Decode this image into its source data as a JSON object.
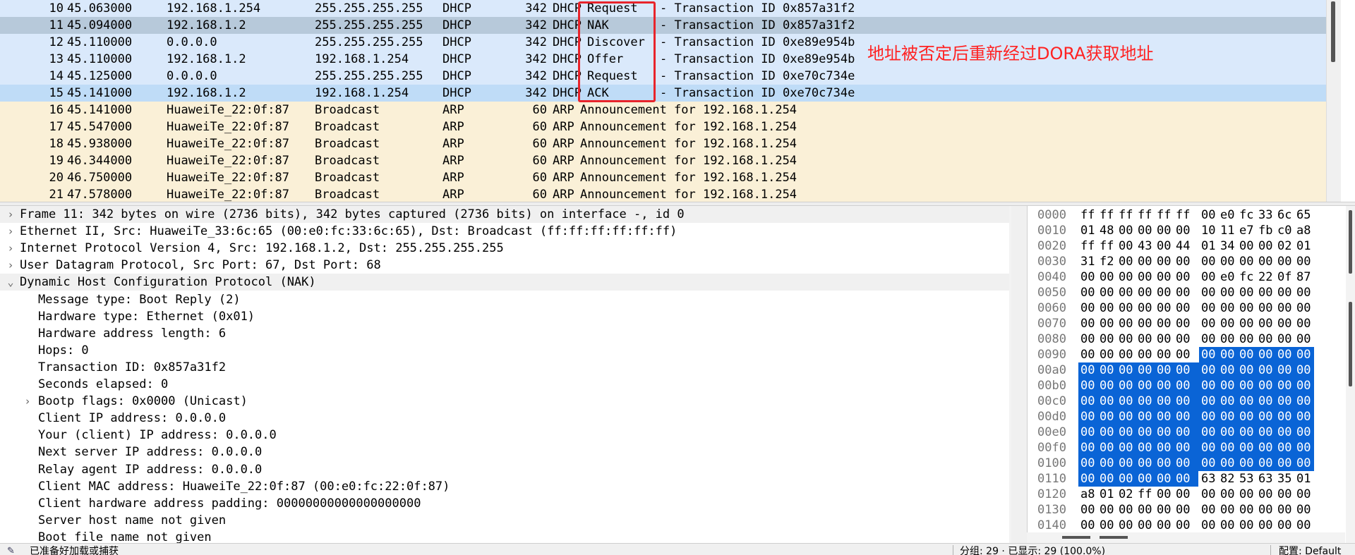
{
  "packet_list": {
    "rows": [
      {
        "no": "10",
        "time": "45.063000",
        "src": "192.168.1.254",
        "dst": "255.255.255.255",
        "proto": "DHCP",
        "len": "342",
        "info_proto": "DHCP",
        "info_type": "Request",
        "info_rest": "- Transaction ID 0x857a31f2",
        "kind": "dhcp"
      },
      {
        "no": "11",
        "time": "45.094000",
        "src": "192.168.1.2",
        "dst": "255.255.255.255",
        "proto": "DHCP",
        "len": "342",
        "info_proto": "DHCP",
        "info_type": "NAK",
        "info_rest": "- Transaction ID 0x857a31f2",
        "kind": "selected"
      },
      {
        "no": "12",
        "time": "45.110000",
        "src": "0.0.0.0",
        "dst": "255.255.255.255",
        "proto": "DHCP",
        "len": "342",
        "info_proto": "DHCP",
        "info_type": "Discover",
        "info_rest": "- Transaction ID 0xe89e954b",
        "kind": "dhcp"
      },
      {
        "no": "13",
        "time": "45.110000",
        "src": "192.168.1.2",
        "dst": "192.168.1.254",
        "proto": "DHCP",
        "len": "342",
        "info_proto": "DHCP",
        "info_type": "Offer",
        "info_rest": "- Transaction ID 0xe89e954b",
        "kind": "dhcp"
      },
      {
        "no": "14",
        "time": "45.125000",
        "src": "0.0.0.0",
        "dst": "255.255.255.255",
        "proto": "DHCP",
        "len": "342",
        "info_proto": "DHCP",
        "info_type": "Request",
        "info_rest": "- Transaction ID 0xe70c734e",
        "kind": "dhcp"
      },
      {
        "no": "15",
        "time": "45.141000",
        "src": "192.168.1.2",
        "dst": "192.168.1.254",
        "proto": "DHCP",
        "len": "342",
        "info_proto": "DHCP",
        "info_type": "ACK",
        "info_rest": "- Transaction ID 0xe70c734e",
        "kind": "highlight"
      },
      {
        "no": "16",
        "time": "45.141000",
        "src": "HuaweiTe_22:0f:87",
        "dst": "Broadcast",
        "proto": "ARP",
        "len": "60",
        "info_proto": "ARP",
        "info_type": "Announcement for 192.168.1.254",
        "info_rest": "",
        "kind": "arp"
      },
      {
        "no": "17",
        "time": "45.547000",
        "src": "HuaweiTe_22:0f:87",
        "dst": "Broadcast",
        "proto": "ARP",
        "len": "60",
        "info_proto": "ARP",
        "info_type": "Announcement for 192.168.1.254",
        "info_rest": "",
        "kind": "arp"
      },
      {
        "no": "18",
        "time": "45.938000",
        "src": "HuaweiTe_22:0f:87",
        "dst": "Broadcast",
        "proto": "ARP",
        "len": "60",
        "info_proto": "ARP",
        "info_type": "Announcement for 192.168.1.254",
        "info_rest": "",
        "kind": "arp"
      },
      {
        "no": "19",
        "time": "46.344000",
        "src": "HuaweiTe_22:0f:87",
        "dst": "Broadcast",
        "proto": "ARP",
        "len": "60",
        "info_proto": "ARP",
        "info_type": "Announcement for 192.168.1.254",
        "info_rest": "",
        "kind": "arp"
      },
      {
        "no": "20",
        "time": "46.750000",
        "src": "HuaweiTe_22:0f:87",
        "dst": "Broadcast",
        "proto": "ARP",
        "len": "60",
        "info_proto": "ARP",
        "info_type": "Announcement for 192.168.1.254",
        "info_rest": "",
        "kind": "arp"
      },
      {
        "no": "21",
        "time": "47.578000",
        "src": "HuaweiTe_22:0f:87",
        "dst": "Broadcast",
        "proto": "ARP",
        "len": "60",
        "info_proto": "ARP",
        "info_type": "Announcement for 192.168.1.254",
        "info_rest": "",
        "kind": "arp"
      }
    ],
    "annotation": "地址被否定后重新经过DORA获取地址"
  },
  "details": {
    "lines": [
      {
        "text": "Frame 11: 342 bytes on wire (2736 bits), 342 bytes captured (2736 bits) on interface -, id 0",
        "level": 0,
        "arrow": "right",
        "grey": true
      },
      {
        "text": "Ethernet II, Src: HuaweiTe_33:6c:65 (00:e0:fc:33:6c:65), Dst: Broadcast (ff:ff:ff:ff:ff:ff)",
        "level": 0,
        "arrow": "right",
        "grey": false
      },
      {
        "text": "Internet Protocol Version 4, Src: 192.168.1.2, Dst: 255.255.255.255",
        "level": 0,
        "arrow": "right",
        "grey": false
      },
      {
        "text": "User Datagram Protocol, Src Port: 67, Dst Port: 68",
        "level": 0,
        "arrow": "right",
        "grey": false
      },
      {
        "text": "Dynamic Host Configuration Protocol (NAK)",
        "level": 0,
        "arrow": "down",
        "grey": true
      },
      {
        "text": "Message type: Boot Reply (2)",
        "level": 1,
        "arrow": "",
        "grey": false
      },
      {
        "text": "Hardware type: Ethernet (0x01)",
        "level": 1,
        "arrow": "",
        "grey": false
      },
      {
        "text": "Hardware address length: 6",
        "level": 1,
        "arrow": "",
        "grey": false
      },
      {
        "text": "Hops: 0",
        "level": 1,
        "arrow": "",
        "grey": false
      },
      {
        "text": "Transaction ID: 0x857a31f2",
        "level": 1,
        "arrow": "",
        "grey": false
      },
      {
        "text": "Seconds elapsed: 0",
        "level": 1,
        "arrow": "",
        "grey": false
      },
      {
        "text": "Bootp flags: 0x0000 (Unicast)",
        "level": 1,
        "arrow": "right",
        "grey": false
      },
      {
        "text": "Client IP address: 0.0.0.0",
        "level": 1,
        "arrow": "",
        "grey": false
      },
      {
        "text": "Your (client) IP address: 0.0.0.0",
        "level": 1,
        "arrow": "",
        "grey": false
      },
      {
        "text": "Next server IP address: 0.0.0.0",
        "level": 1,
        "arrow": "",
        "grey": false
      },
      {
        "text": "Relay agent IP address: 0.0.0.0",
        "level": 1,
        "arrow": "",
        "grey": false
      },
      {
        "text": "Client MAC address: HuaweiTe_22:0f:87 (00:e0:fc:22:0f:87)",
        "level": 1,
        "arrow": "",
        "grey": false
      },
      {
        "text": "Client hardware address padding: 00000000000000000000",
        "level": 1,
        "arrow": "",
        "grey": false
      },
      {
        "text": "Server host name not given",
        "level": 1,
        "arrow": "",
        "grey": false
      },
      {
        "text": "Boot file name not given",
        "level": 1,
        "arrow": "",
        "grey": false
      }
    ]
  },
  "bytes": {
    "rows": [
      {
        "offset": "0000",
        "hex": [
          "ff",
          "ff",
          "ff",
          "ff",
          "ff",
          "ff",
          "00",
          "e0",
          "fc",
          "33",
          "6c",
          "65"
        ],
        "sel_from": -1
      },
      {
        "offset": "0010",
        "hex": [
          "01",
          "48",
          "00",
          "00",
          "00",
          "00",
          "10",
          "11",
          "e7",
          "fb",
          "c0",
          "a8"
        ],
        "sel_from": -1
      },
      {
        "offset": "0020",
        "hex": [
          "ff",
          "ff",
          "00",
          "43",
          "00",
          "44",
          "01",
          "34",
          "00",
          "00",
          "02",
          "01"
        ],
        "sel_from": -1
      },
      {
        "offset": "0030",
        "hex": [
          "31",
          "f2",
          "00",
          "00",
          "00",
          "00",
          "00",
          "00",
          "00",
          "00",
          "00",
          "00"
        ],
        "sel_from": -1
      },
      {
        "offset": "0040",
        "hex": [
          "00",
          "00",
          "00",
          "00",
          "00",
          "00",
          "00",
          "e0",
          "fc",
          "22",
          "0f",
          "87"
        ],
        "sel_from": -1
      },
      {
        "offset": "0050",
        "hex": [
          "00",
          "00",
          "00",
          "00",
          "00",
          "00",
          "00",
          "00",
          "00",
          "00",
          "00",
          "00"
        ],
        "sel_from": -1
      },
      {
        "offset": "0060",
        "hex": [
          "00",
          "00",
          "00",
          "00",
          "00",
          "00",
          "00",
          "00",
          "00",
          "00",
          "00",
          "00"
        ],
        "sel_from": -1
      },
      {
        "offset": "0070",
        "hex": [
          "00",
          "00",
          "00",
          "00",
          "00",
          "00",
          "00",
          "00",
          "00",
          "00",
          "00",
          "00"
        ],
        "sel_from": -1
      },
      {
        "offset": "0080",
        "hex": [
          "00",
          "00",
          "00",
          "00",
          "00",
          "00",
          "00",
          "00",
          "00",
          "00",
          "00",
          "00"
        ],
        "sel_from": -1
      },
      {
        "offset": "0090",
        "hex": [
          "00",
          "00",
          "00",
          "00",
          "00",
          "00",
          "00",
          "00",
          "00",
          "00",
          "00",
          "00"
        ],
        "sel_from": 6
      },
      {
        "offset": "00a0",
        "hex": [
          "00",
          "00",
          "00",
          "00",
          "00",
          "00",
          "00",
          "00",
          "00",
          "00",
          "00",
          "00"
        ],
        "sel_from": 0
      },
      {
        "offset": "00b0",
        "hex": [
          "00",
          "00",
          "00",
          "00",
          "00",
          "00",
          "00",
          "00",
          "00",
          "00",
          "00",
          "00"
        ],
        "sel_from": 0
      },
      {
        "offset": "00c0",
        "hex": [
          "00",
          "00",
          "00",
          "00",
          "00",
          "00",
          "00",
          "00",
          "00",
          "00",
          "00",
          "00"
        ],
        "sel_from": 0
      },
      {
        "offset": "00d0",
        "hex": [
          "00",
          "00",
          "00",
          "00",
          "00",
          "00",
          "00",
          "00",
          "00",
          "00",
          "00",
          "00"
        ],
        "sel_from": 0
      },
      {
        "offset": "00e0",
        "hex": [
          "00",
          "00",
          "00",
          "00",
          "00",
          "00",
          "00",
          "00",
          "00",
          "00",
          "00",
          "00"
        ],
        "sel_from": 0
      },
      {
        "offset": "00f0",
        "hex": [
          "00",
          "00",
          "00",
          "00",
          "00",
          "00",
          "00",
          "00",
          "00",
          "00",
          "00",
          "00"
        ],
        "sel_from": 0
      },
      {
        "offset": "0100",
        "hex": [
          "00",
          "00",
          "00",
          "00",
          "00",
          "00",
          "00",
          "00",
          "00",
          "00",
          "00",
          "00"
        ],
        "sel_from": 0
      },
      {
        "offset": "0110",
        "hex": [
          "00",
          "00",
          "00",
          "00",
          "00",
          "00",
          "63",
          "82",
          "53",
          "63",
          "35",
          "01"
        ],
        "sel_from": 0,
        "sel_to": 6
      },
      {
        "offset": "0120",
        "hex": [
          "a8",
          "01",
          "02",
          "ff",
          "00",
          "00",
          "00",
          "00",
          "00",
          "00",
          "00",
          "00"
        ],
        "sel_from": -1
      },
      {
        "offset": "0130",
        "hex": [
          "00",
          "00",
          "00",
          "00",
          "00",
          "00",
          "00",
          "00",
          "00",
          "00",
          "00",
          "00"
        ],
        "sel_from": -1
      },
      {
        "offset": "0140",
        "hex": [
          "00",
          "00",
          "00",
          "00",
          "00",
          "00",
          "00",
          "00",
          "00",
          "00",
          "00",
          "00"
        ],
        "sel_from": -1
      }
    ]
  },
  "status": {
    "text": "已准备好加载或捕获",
    "stats": "分组: 29 · 已显示: 29 (100.0%)",
    "profile": "配置: Default"
  },
  "colors": {
    "dhcp_row": "#dae9fb",
    "arp_row": "#faf0d7",
    "selected_row": "#b7c9da",
    "highlight_row": "#bfdcf7",
    "byte_selection": "#0a64d6",
    "annotation": "#ff2222",
    "red_box": "#e8242b"
  }
}
